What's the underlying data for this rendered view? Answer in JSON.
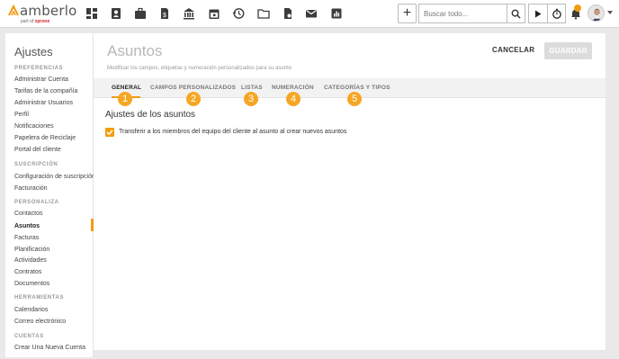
{
  "brand": {
    "name": "amberlo",
    "tagline_prefix": "part of",
    "tagline_brand": "xprone",
    "accent_color": "#f39c12"
  },
  "topbar": {
    "icons": [
      "dashboard-icon",
      "contacts-icon",
      "briefcase-icon",
      "invoice-icon",
      "bank-icon",
      "calendar-icon",
      "history-icon",
      "folder-icon",
      "document-icon",
      "mail-icon",
      "reports-icon"
    ],
    "search_placeholder": "Buscar todo...",
    "plus_label": "+"
  },
  "sidebar": {
    "title": "Ajustes",
    "sections": [
      {
        "heading": "PREFERENCIAS",
        "items": [
          "Administrar Cuenta",
          "Tarifas de la compañía",
          "Administrar Usuarios",
          "Perfil",
          "Notificaciones",
          "Papelera de Reciclaje",
          "Portal del cliente"
        ]
      },
      {
        "heading": "SUSCRIPCIÓN",
        "items": [
          "Configuración de suscripción",
          "Facturación"
        ]
      },
      {
        "heading": "PERSONALIZA",
        "items": [
          "Contactos",
          "Asuntos",
          "Facturas",
          "Planificación",
          "Actividades",
          "Contratos",
          "Documentos"
        ]
      },
      {
        "heading": "HERRAMIENTAS",
        "items": [
          "Calendarios",
          "Correo electrónico"
        ]
      },
      {
        "heading": "CUENTAS",
        "items": [
          "Crear Una Nueva Cuenta"
        ]
      }
    ],
    "active_item": "Asuntos"
  },
  "main": {
    "title": "Asuntos",
    "subtitle": "Modificar los campos, etiquetas y numeración personalizados para su asunto",
    "cancel_label": "CANCELAR",
    "save_label": "GUARDAR",
    "tabs": [
      {
        "label": "GENERAL",
        "badge": "1"
      },
      {
        "label": "CAMPOS PERSONALIZADOS",
        "badge": "2"
      },
      {
        "label": "LISTAS",
        "badge": "3"
      },
      {
        "label": "NUMERACIÓN",
        "badge": "4"
      },
      {
        "label": "CATEGORÍAS Y TIPOS",
        "badge": "5"
      }
    ],
    "section_title": "Ajustes de los asuntos",
    "checkbox_label": "Transferir a los miembros del equipo del cliente al asunto al crear nuevos asuntos",
    "checkbox_checked": true
  }
}
